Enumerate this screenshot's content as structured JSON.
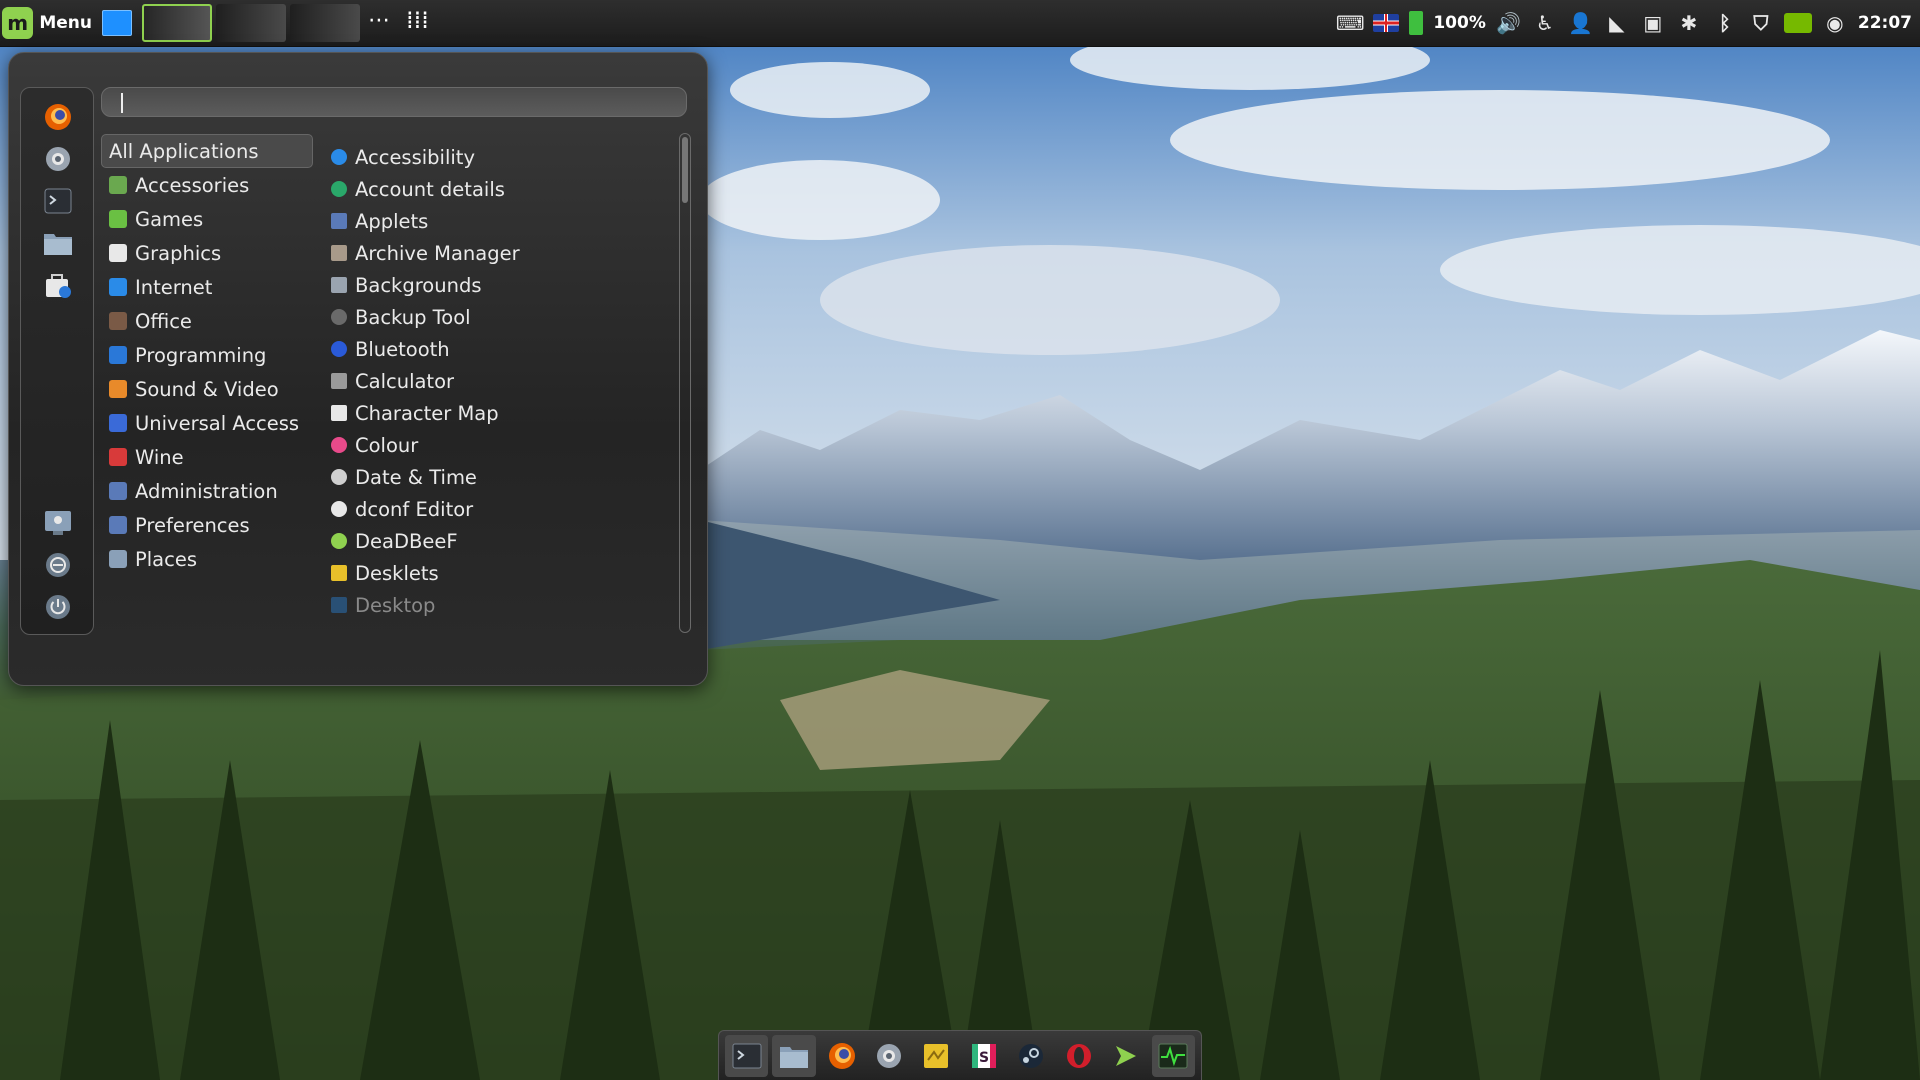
{
  "panel": {
    "menu_label": "Menu",
    "battery_percent": "100%",
    "clock": "22:07",
    "workspace_count": 3,
    "active_workspace": 1,
    "tray_icons": [
      "keyboard-icon",
      "uk-flag-icon",
      "battery-icon",
      "volume-icon",
      "accessibility-icon",
      "user-icon",
      "wifi-icon",
      "screenshot-icon",
      "settings-icon",
      "bluetooth-icon",
      "shield-icon",
      "nvidia-icon",
      "updates-icon"
    ],
    "colors": {
      "accent": "#8fd14f",
      "show_desktop": "#1e90ff",
      "battery": "#3fbf3f",
      "nvidia": "#76b900"
    }
  },
  "menu": {
    "search": {
      "value": "",
      "placeholder": ""
    },
    "favorites": [
      "firefox-icon",
      "system-settings-icon",
      "terminal-icon",
      "files-icon",
      "software-manager-icon"
    ],
    "session": [
      "lock-screen-icon",
      "logout-icon",
      "power-icon"
    ],
    "categories": [
      {
        "label": "All Applications",
        "icon": "all-apps-icon",
        "color": "#000000",
        "selected": true
      },
      {
        "label": "Accessories",
        "icon": "accessories-icon",
        "color": "#6aa84f",
        "selected": false
      },
      {
        "label": "Games",
        "icon": "games-icon",
        "color": "#6ac043",
        "selected": false
      },
      {
        "label": "Graphics",
        "icon": "graphics-icon",
        "color": "#e8e8e8",
        "selected": false
      },
      {
        "label": "Internet",
        "icon": "internet-icon",
        "color": "#2a8be8",
        "selected": false
      },
      {
        "label": "Office",
        "icon": "office-icon",
        "color": "#7a5a46",
        "selected": false
      },
      {
        "label": "Programming",
        "icon": "programming-icon",
        "color": "#2a78d8",
        "selected": false
      },
      {
        "label": "Sound & Video",
        "icon": "sound-video-icon",
        "color": "#e88a2a",
        "selected": false
      },
      {
        "label": "Universal Access",
        "icon": "universal-access-icon",
        "color": "#3a6ad8",
        "selected": false
      },
      {
        "label": "Wine",
        "icon": "wine-icon",
        "color": "#d83a3a",
        "selected": false
      },
      {
        "label": "Administration",
        "icon": "administration-icon",
        "color": "#5a7ab8",
        "selected": false
      },
      {
        "label": "Preferences",
        "icon": "preferences-icon",
        "color": "#5a7ab8",
        "selected": false
      },
      {
        "label": "Places",
        "icon": "places-icon",
        "color": "#8aa0b8",
        "selected": false
      }
    ],
    "applications": [
      {
        "label": "Accessibility",
        "icon": "accessibility-icon",
        "color": "#2a8be8"
      },
      {
        "label": "Account details",
        "icon": "account-details-icon",
        "color": "#2aa86a"
      },
      {
        "label": "Applets",
        "icon": "applets-icon",
        "color": "#5a7ab8"
      },
      {
        "label": "Archive Manager",
        "icon": "archive-manager-icon",
        "color": "#a89a8a"
      },
      {
        "label": "Backgrounds",
        "icon": "backgrounds-icon",
        "color": "#9aa4b0"
      },
      {
        "label": "Backup Tool",
        "icon": "backup-tool-icon",
        "color": "#6a6a6a"
      },
      {
        "label": "Bluetooth",
        "icon": "bluetooth-icon",
        "color": "#2a5ad8"
      },
      {
        "label": "Calculator",
        "icon": "calculator-icon",
        "color": "#9a9a9a"
      },
      {
        "label": "Character Map",
        "icon": "character-map-icon",
        "color": "#e8e8e8"
      },
      {
        "label": "Colour",
        "icon": "colour-icon",
        "color": "#e84a8a"
      },
      {
        "label": "Date & Time",
        "icon": "date-time-icon",
        "color": "#cfcfcf"
      },
      {
        "label": "dconf Editor",
        "icon": "dconf-editor-icon",
        "color": "#e8e8e8"
      },
      {
        "label": "DeaDBeeF",
        "icon": "deadbeef-icon",
        "color": "#8fd14f"
      },
      {
        "label": "Desklets",
        "icon": "desklets-icon",
        "color": "#e8c02a"
      },
      {
        "label": "Desktop",
        "icon": "desktop-icon",
        "color": "#2a6aa8",
        "faded": true
      }
    ],
    "scroll_position": 0.0
  },
  "dock": {
    "items": [
      {
        "icon": "terminal-icon",
        "running": true
      },
      {
        "icon": "files-icon",
        "running": true
      },
      {
        "icon": "firefox-icon",
        "running": false
      },
      {
        "icon": "settings-icon",
        "running": false
      },
      {
        "icon": "sticky-notes-icon",
        "running": false
      },
      {
        "icon": "slack-icon",
        "running": false
      },
      {
        "icon": "steam-icon",
        "running": false
      },
      {
        "icon": "opera-icon",
        "running": false
      },
      {
        "icon": "deadbeef-icon",
        "running": false
      },
      {
        "icon": "system-monitor-icon",
        "running": true
      }
    ]
  }
}
